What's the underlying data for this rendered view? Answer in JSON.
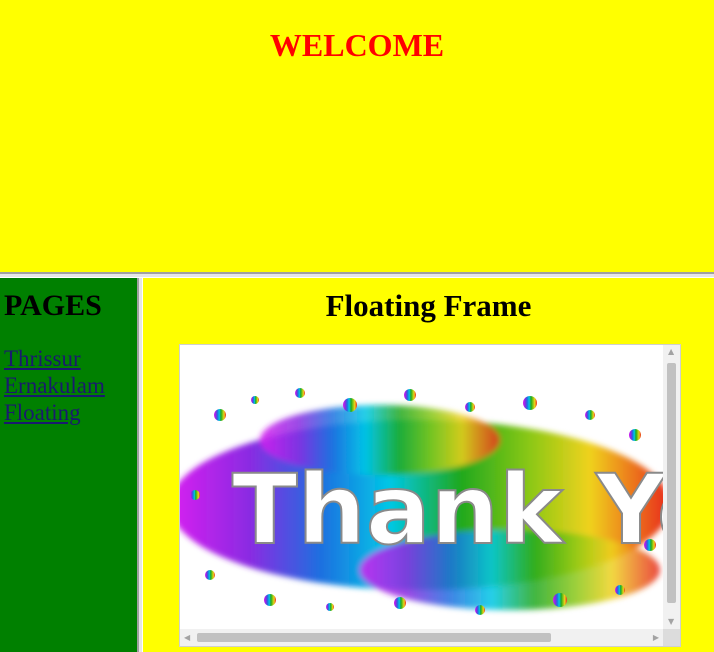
{
  "header": {
    "title": "WELCOME"
  },
  "sidebar": {
    "title": "PAGES",
    "links": [
      {
        "label": "Thrissur"
      },
      {
        "label": "Ernakulam"
      },
      {
        "label": "Floating"
      }
    ]
  },
  "main": {
    "title": "Floating Frame",
    "iframe": {
      "image_text": "Thank You"
    }
  },
  "colors": {
    "page_background": "#ffff00",
    "header_text": "#ff0000",
    "sidebar_background": "#008000",
    "link_text": "#1a1a6e"
  },
  "icons": [
    "scroll-up-arrow-icon",
    "scroll-down-arrow-icon",
    "scroll-left-arrow-icon",
    "scroll-right-arrow-icon"
  ]
}
